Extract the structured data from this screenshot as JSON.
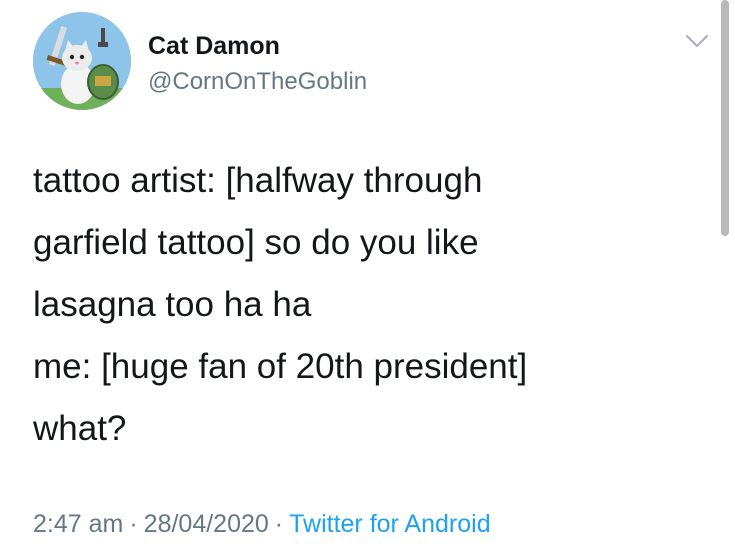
{
  "author": {
    "display_name": "Cat Damon",
    "handle": "@CornOnTheGoblin",
    "avatar_icon": "cat-knight-avatar"
  },
  "tweet": {
    "lines": [
      "tattoo artist: [halfway through",
      "garfield tattoo] so do you like",
      "lasagna too ha ha",
      "me: [huge fan of 20th president]",
      "what?"
    ]
  },
  "meta": {
    "time": "2:47 am",
    "separator": "·",
    "date": "28/04/2020",
    "source": "Twitter for Android"
  },
  "icons": {
    "menu": "chevron-down-icon"
  },
  "colors": {
    "text": "#14171a",
    "secondary": "#657786",
    "link": "#1da1f2",
    "avatar_bg": "#8fc4ea"
  }
}
